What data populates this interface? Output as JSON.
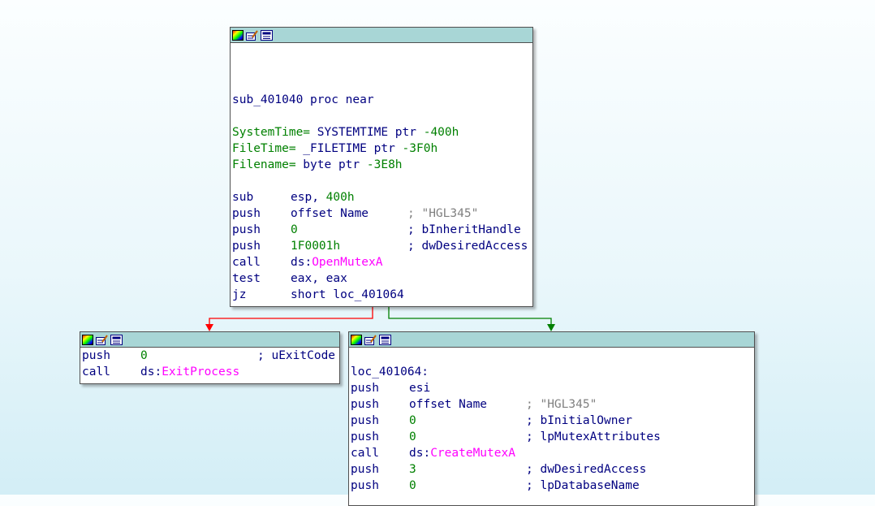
{
  "nodes": {
    "top": {
      "header": "sub_401040 proc near",
      "vars": [
        {
          "name": "SystemTime=",
          "type": " SYSTEMTIME ptr ",
          "offset": "-400h"
        },
        {
          "name": "FileTime=",
          "type": " _FILETIME ptr ",
          "offset": "-3F0h"
        },
        {
          "name": "Filename=",
          "type": " byte ptr ",
          "offset": "-3E8h"
        }
      ],
      "instructions": [
        {
          "mnemonic": "sub",
          "operand": "esp, ",
          "operand_num": "400h",
          "comment": ""
        },
        {
          "mnemonic": "push",
          "operand": "offset Name",
          "comment": "; \"HGL345\"",
          "comment_gray": true
        },
        {
          "mnemonic": "push",
          "operand_num": "0",
          "comment": "; bInheritHandle"
        },
        {
          "mnemonic": "push",
          "operand_num": "1F0001h",
          "comment": "; dwDesiredAccess"
        },
        {
          "mnemonic": "call",
          "operand": "ds:",
          "operand_func": "OpenMutexA",
          "comment": ""
        },
        {
          "mnemonic": "test",
          "operand": "eax, eax",
          "comment": ""
        },
        {
          "mnemonic": "jz",
          "operand": "short loc_401064",
          "comment": ""
        }
      ]
    },
    "left": {
      "instructions": [
        {
          "mnemonic": "push",
          "operand_num": "0",
          "comment": "; uExitCode"
        },
        {
          "mnemonic": "call",
          "operand": "ds:",
          "operand_func": "ExitProcess",
          "comment": ""
        }
      ]
    },
    "right": {
      "label": "loc_401064:",
      "instructions": [
        {
          "mnemonic": "push",
          "operand": "esi",
          "comment": ""
        },
        {
          "mnemonic": "push",
          "operand": "offset Name",
          "comment": "; \"HGL345\"",
          "comment_gray": true
        },
        {
          "mnemonic": "push",
          "operand_num": "0",
          "comment": "; bInitialOwner"
        },
        {
          "mnemonic": "push",
          "operand_num": "0",
          "comment": "; lpMutexAttributes"
        },
        {
          "mnemonic": "call",
          "operand": "ds:",
          "operand_func": "CreateMutexA",
          "comment": ""
        },
        {
          "mnemonic": "push",
          "operand_num": "3",
          "comment": "; dwDesiredAccess"
        },
        {
          "mnemonic": "push",
          "operand_num": "0",
          "comment": "; lpDatabaseName"
        }
      ]
    }
  },
  "edges": {
    "false_color": "#ff0000",
    "true_color": "#008000"
  },
  "colors": {
    "titlebar": "#a8d6d6",
    "mnemonic": "#000080",
    "number": "#008000",
    "import_function": "#ff00ff",
    "string_comment": "#808080"
  },
  "titlebar_icons": [
    "color-palette-icon",
    "rename-node-icon",
    "group-nodes-icon"
  ]
}
